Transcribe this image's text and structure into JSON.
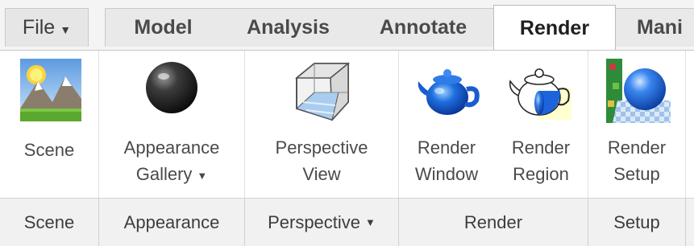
{
  "menu": {
    "file_label": "File"
  },
  "tabs": [
    {
      "label": "Model",
      "active": false
    },
    {
      "label": "Analysis",
      "active": false
    },
    {
      "label": "Annotate",
      "active": false
    },
    {
      "label": "Render",
      "active": true
    },
    {
      "label": "Mani",
      "active": false
    }
  ],
  "ribbon": {
    "buttons": [
      {
        "line1": "Scene",
        "line2": "",
        "icon": "scene-landscape-icon"
      },
      {
        "line1": "Appearance",
        "line2": "Gallery",
        "icon": "appearance-sphere-icon",
        "has_dropdown": true
      },
      {
        "line1": "Perspective",
        "line2": "View",
        "icon": "perspective-cube-icon"
      },
      {
        "line1": "Render",
        "line2": "Window",
        "icon": "teapot-icon"
      },
      {
        "line1": "Render",
        "line2": "Region",
        "icon": "teapot-region-icon"
      },
      {
        "line1": "Render",
        "line2": "Setup",
        "icon": "render-setup-sphere-icon"
      }
    ]
  },
  "groups": [
    {
      "label": "Scene"
    },
    {
      "label": "Appearance"
    },
    {
      "label": "Perspective",
      "has_dropdown": true
    },
    {
      "label": "Render"
    },
    {
      "label": "Setup"
    }
  ],
  "colors": {
    "active_tab": "#ffffff",
    "tab_strip": "#e9e9e9",
    "group_bar": "#f1f1f1",
    "separator": "#d0d0d0"
  }
}
